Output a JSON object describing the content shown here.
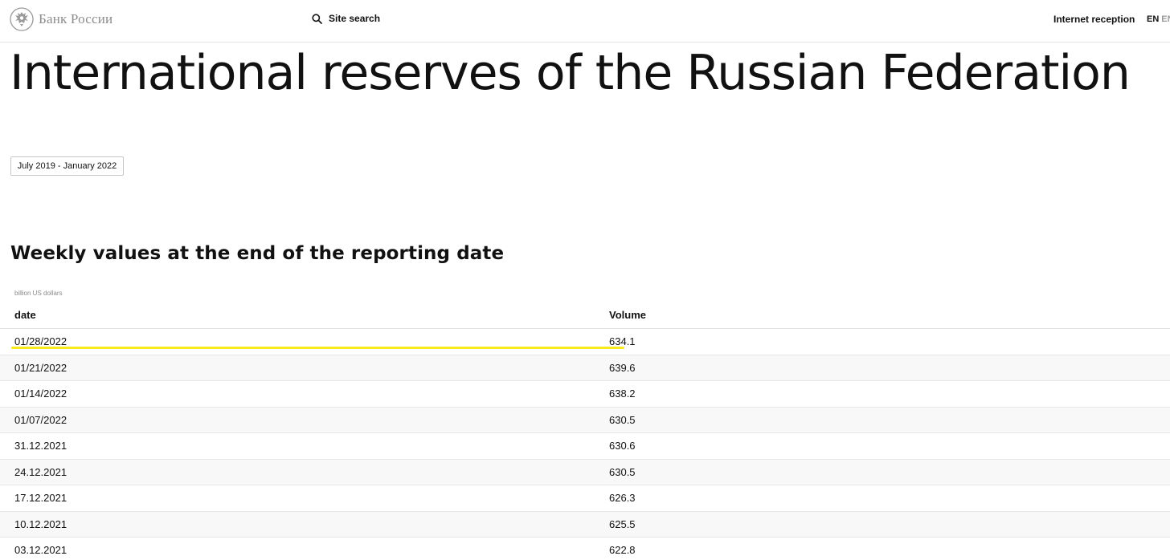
{
  "header": {
    "logo_text": "Банк России",
    "search_label": "Site search",
    "reception_label": "Internet reception",
    "lang_active": "EN",
    "lang_inactive": "EN"
  },
  "page_title": "International reserves of the Russian Federation",
  "period_button_label": "July 2019 - January 2022",
  "section": {
    "title": "Weekly values at the end of the reporting date",
    "unit": "billion US dollars"
  },
  "table": {
    "columns": [
      "date",
      "Volume"
    ],
    "rows": [
      {
        "date": "01/28/2022",
        "volume": "634.1"
      },
      {
        "date": "01/21/2022",
        "volume": "639.6"
      },
      {
        "date": "01/14/2022",
        "volume": "638.2"
      },
      {
        "date": "01/07/2022",
        "volume": "630.5"
      },
      {
        "date": "31.12.2021",
        "volume": "630.6"
      },
      {
        "date": "24.12.2021",
        "volume": "630.5"
      },
      {
        "date": "17.12.2021",
        "volume": "626.3"
      },
      {
        "date": "10.12.2021",
        "volume": "625.5"
      },
      {
        "date": "03.12.2021",
        "volume": "622.8"
      }
    ]
  },
  "colors": {
    "highlight": "#f7ea1e",
    "logo_grey": "#8d8d8d",
    "text": "#111111"
  }
}
